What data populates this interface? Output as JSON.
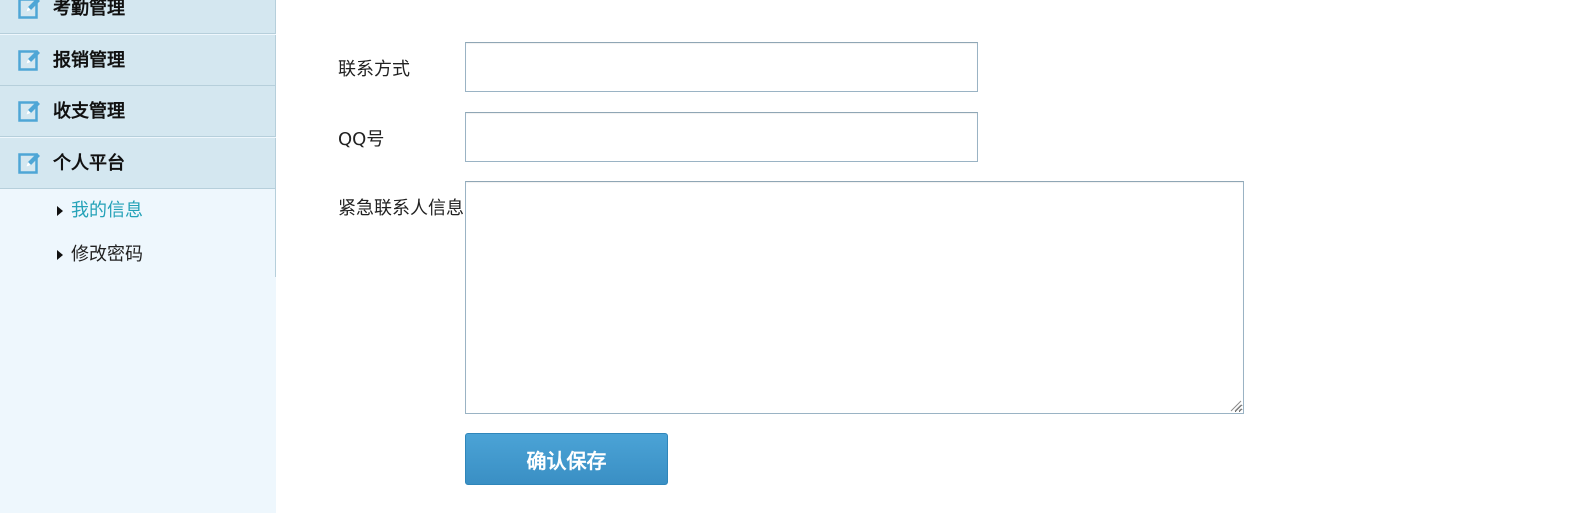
{
  "sidebar": {
    "groups": [
      {
        "label": "考勤管理",
        "icon": "edit-icon"
      },
      {
        "label": "报销管理",
        "icon": "edit-icon"
      },
      {
        "label": "收支管理",
        "icon": "edit-icon"
      },
      {
        "label": "个人平台",
        "icon": "edit-icon"
      }
    ],
    "sub_items": [
      {
        "label": "我的信息",
        "active": true
      },
      {
        "label": "修改密码",
        "active": false
      }
    ]
  },
  "form": {
    "contact_label": "联系方式",
    "contact_value": "",
    "qq_label": "QQ号",
    "qq_value": "",
    "emergency_label": "紧急联系人信息",
    "emergency_value": "",
    "save_label": "确认保存"
  },
  "colors": {
    "sidebar_group_bg": "#d4e7f0",
    "sidebar_bg": "#eef7fd",
    "active_link": "#25a2b8",
    "icon_blue": "#4ea6d6",
    "button_blue": "#3f97cb"
  }
}
